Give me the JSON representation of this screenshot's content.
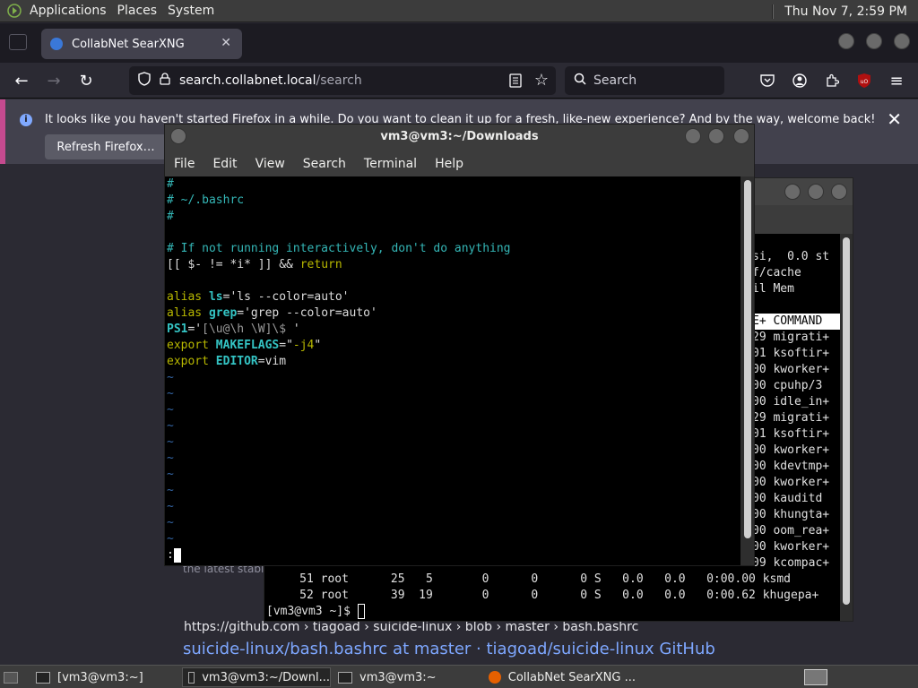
{
  "top_panel": {
    "applications": "Applications",
    "places": "Places",
    "system": "System",
    "clock": "Thu Nov  7,  2:59 PM"
  },
  "firefox": {
    "tab_title": "CollabNet SearXNG",
    "url_host": "search.collabnet.local",
    "url_path": "/search",
    "search_placeholder": "Search",
    "notification": "It looks like you haven't started Firefox in a while. Do you want to clean it up for a fresh, like-new experience? And by the way, welcome back!",
    "refresh_button": "Refresh Firefox…",
    "result_breadcrumb": "https://github.com  › tiagoad › suicide-linux › blob › master › bash.bashrc",
    "result_title": "suicide-linux/bash.bashrc at master · tiagoad/suicide-linux GitHub",
    "result_snippet": "the latest stable"
  },
  "fg_terminal": {
    "title": "vm3@vm3:~/Downloads",
    "menu": [
      "File",
      "Edit",
      "View",
      "Search",
      "Terminal",
      "Help"
    ],
    "lines": {
      "l1": "#",
      "l2": "# ~/.bashrc",
      "l3": "#",
      "l5": "# If not running interactively, don't do anything",
      "l6a": "[[ $- != *i* ]] && ",
      "l6b": "return",
      "l8a": "alias ",
      "l8b": "ls",
      "l8c": "='ls --color=auto'",
      "l9a": "alias ",
      "l9b": "grep",
      "l9c": "='grep --color=auto'",
      "l10a": "PS1",
      "l10b": "='",
      "l10c": "[\\u@\\h \\W]\\$ ",
      "l10d": "'",
      "l11a": "export ",
      "l11b": "MAKEFLAGS",
      "l11c": "=\"",
      "l11d": "-j4",
      "l11e": "\"",
      "l12a": "export ",
      "l12b": "EDITOR",
      "l12c": "=vim",
      "tilde": "~",
      "cmd_prompt": ":"
    }
  },
  "bg_terminal": {
    "rows": [
      "si,  0.0 st",
      "f/cache",
      "il Mem",
      "",
      "E+ COMMAND",
      "29 migrati+",
      "01 ksoftir+",
      "00 kworker+",
      "00 cpuhp/3",
      "00 idle_in+",
      "29 migrati+",
      "01 ksoftir+",
      "00 kworker+",
      "00 kdevtmp+",
      "00 kworker+",
      "00 kauditd",
      "00 khungta+",
      "00 oom_rea+",
      "00 kworker+",
      "09 kcompac+"
    ],
    "full_rows": [
      "     51 root      25   5       0      0      0 S   0.0   0.0   0:00.00 ksmd",
      "     52 root      39  19       0      0      0 S   0.0   0.0   0:00.62 khugepa+"
    ],
    "prompt": "[vm3@vm3 ~]$ "
  },
  "taskbar": {
    "task1": "[vm3@vm3:~]",
    "task2": "vm3@vm3:~/Downl...",
    "task3": "vm3@vm3:~",
    "task4": "CollabNet SearXNG ..."
  }
}
